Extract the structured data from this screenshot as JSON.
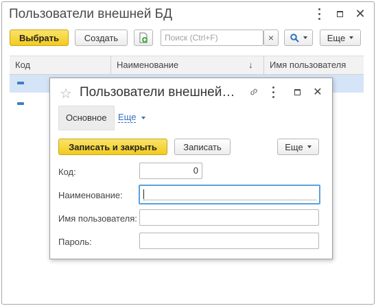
{
  "window": {
    "title": "Пользователи внешней БД"
  },
  "toolbar": {
    "choose_label": "Выбрать",
    "create_label": "Создать",
    "search_placeholder": "Поиск (Ctrl+F)",
    "search_clear": "×",
    "more_label": "Еще"
  },
  "table": {
    "columns": [
      "Код",
      "Наименование",
      "Имя пользователя"
    ],
    "sort_indicator": "↓"
  },
  "dialog": {
    "title": "Пользователи внешней…",
    "tabs": {
      "main": "Основное",
      "more": "Еще"
    },
    "buttons": {
      "save_close": "Записать и закрыть",
      "save": "Записать",
      "more": "Еще"
    },
    "fields": {
      "code": {
        "label": "Код:",
        "value": "0"
      },
      "name": {
        "label": "Наименование:",
        "value": ""
      },
      "username": {
        "label": "Имя пользователя:",
        "value": ""
      },
      "password": {
        "label": "Пароль:",
        "value": ""
      }
    }
  },
  "colors": {
    "accent_yellow": "#f2cb1d",
    "selected_row": "#d5e4f7",
    "link": "#2f6fbe"
  }
}
